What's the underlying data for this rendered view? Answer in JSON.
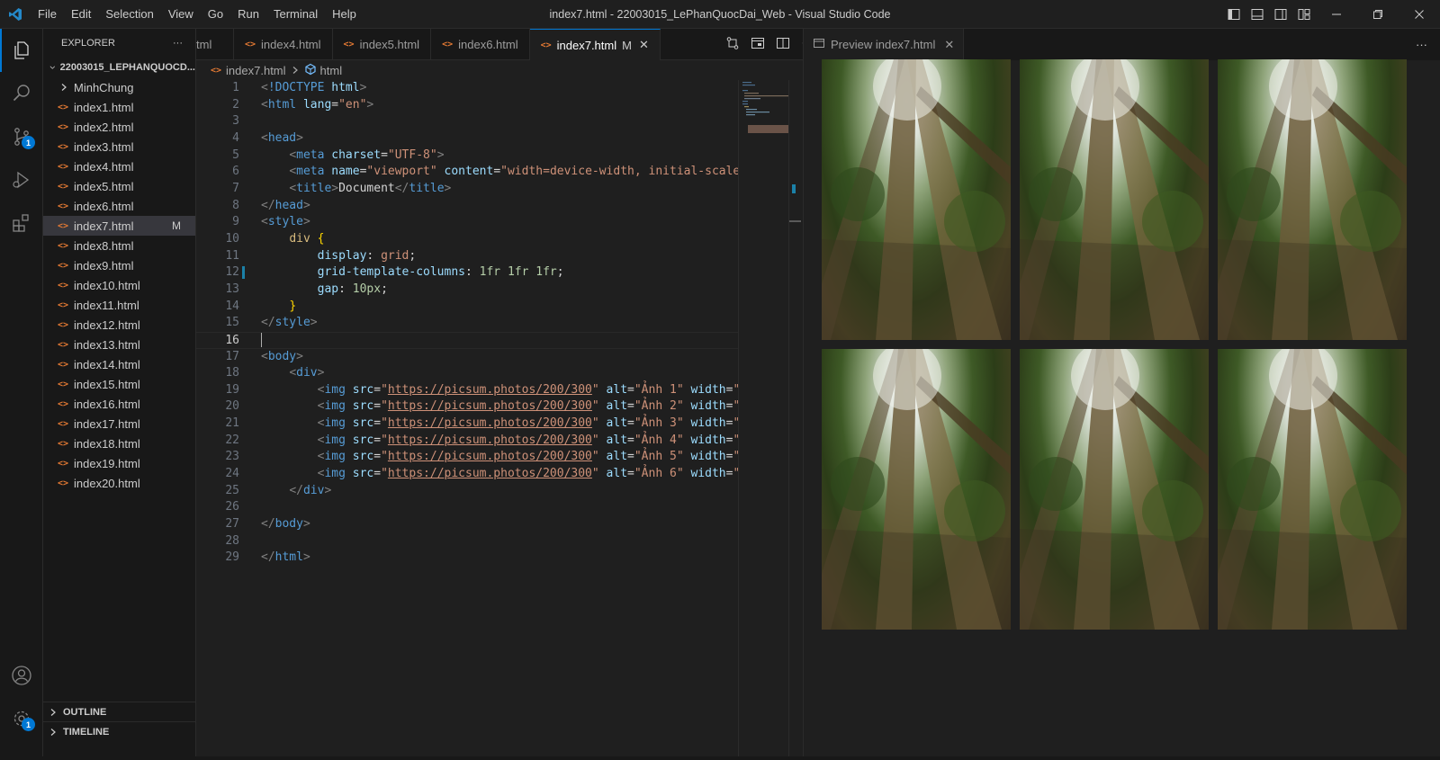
{
  "titlebar": {
    "menu": [
      "File",
      "Edit",
      "Selection",
      "View",
      "Go",
      "Run",
      "Terminal",
      "Help"
    ],
    "window_title": "index7.html - 22003015_LePhanQuocDai_Web - Visual Studio Code"
  },
  "activity_bar": {
    "items": [
      "explorer-icon",
      "search-icon",
      "source-control-icon",
      "run-debug-icon",
      "extensions-icon"
    ],
    "source_control_badge": "1",
    "settings_badge": "1"
  },
  "explorer": {
    "title": "EXPLORER",
    "more": "···",
    "folder": "22003015_LEPHANQUOCD...",
    "subfolder": "MinhChung",
    "files": [
      "index1.html",
      "index2.html",
      "index3.html",
      "index4.html",
      "index5.html",
      "index6.html",
      "index7.html",
      "index8.html",
      "index9.html",
      "index10.html",
      "index11.html",
      "index12.html",
      "index13.html",
      "index14.html",
      "index15.html",
      "index16.html",
      "index17.html",
      "index18.html",
      "index19.html",
      "index20.html"
    ],
    "selected_file": "index7.html",
    "modified_marker": "M",
    "outline": "OUTLINE",
    "timeline": "TIMELINE"
  },
  "tabs": {
    "items": [
      {
        "label": "tml"
      },
      {
        "label": "index4.html"
      },
      {
        "label": "index5.html"
      },
      {
        "label": "index6.html"
      },
      {
        "label": "index7.html",
        "modified": "M",
        "close": "✕"
      }
    ],
    "file_icon": "<>"
  },
  "breadcrumb": {
    "file": "index7.html",
    "symbol": "html"
  },
  "editor": {
    "current_line": 16
  },
  "preview": {
    "tab_label": "Preview index7.html",
    "close": "✕",
    "more": "···",
    "image_count": 6
  }
}
